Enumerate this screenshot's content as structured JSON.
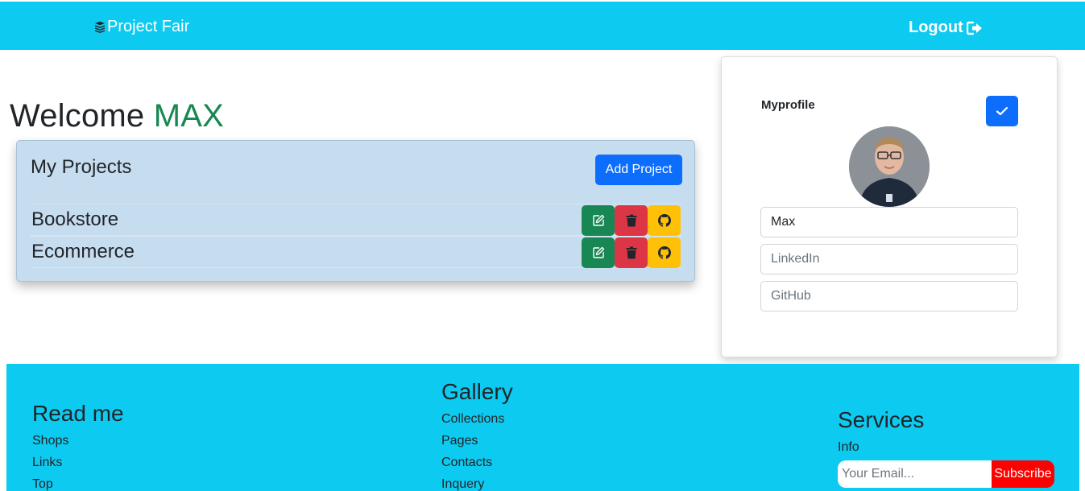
{
  "navbar": {
    "brand": "Project Fair",
    "brand_icon": "stack-icon",
    "logout": "Logout",
    "logout_icon": "sign-out-icon",
    "bg_color": "#0dcaf0"
  },
  "welcome": {
    "prefix": "Welcome",
    "name": "MAX",
    "name_color": "#198754"
  },
  "projects": {
    "title": "My Projects",
    "add_button": "Add Project",
    "items": [
      {
        "name": "Bookstore"
      },
      {
        "name": "Ecommerce"
      }
    ],
    "action_icons": [
      "edit-icon",
      "trash-icon",
      "github-icon"
    ]
  },
  "profile": {
    "title": "Myprofile",
    "name_value": "Max",
    "linkedin_placeholder": "LinkedIn",
    "github_placeholder": "GitHub"
  },
  "footer": {
    "col1": {
      "heading": "Read me",
      "links": [
        "Shops",
        "Links",
        "Top"
      ]
    },
    "col2": {
      "heading": "Gallery",
      "links": [
        "Collections",
        "Pages",
        "Contacts",
        "Inquery"
      ]
    },
    "col3": {
      "heading": "Services",
      "info": "Info",
      "email_placeholder": "Your Email...",
      "subscribe": "Subscribe"
    }
  }
}
